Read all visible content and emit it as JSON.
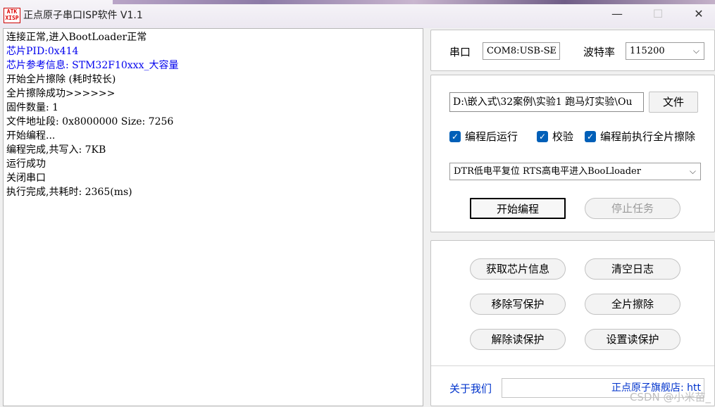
{
  "window": {
    "icon_text": "ATK XISP",
    "title": "正点原子串口ISP软件 V1.1",
    "minimize": "—",
    "maximize": "☐",
    "close": "✕"
  },
  "log": [
    {
      "text": "连接正常,进入BootLoader正常",
      "color": "#000000"
    },
    {
      "text": "芯片PID:0x414",
      "color": "#0000ee"
    },
    {
      "text": "芯片参考信息: STM32F10xxx_大容量",
      "color": "#0000ee"
    },
    {
      "text": "开始全片擦除 (耗时较长)",
      "color": "#000000"
    },
    {
      "text": "全片擦除成功>>>>>>",
      "color": "#000000"
    },
    {
      "text": "固件数量: 1",
      "color": "#000000"
    },
    {
      "text": "文件地址段: 0x8000000 Size: 7256",
      "color": "#000000"
    },
    {
      "text": "开始编程...",
      "color": "#000000"
    },
    {
      "text": "编程完成,共写入: 7KB",
      "color": "#000000"
    },
    {
      "text": "运行成功",
      "color": "#000000"
    },
    {
      "text": "关闭串口",
      "color": "#000000"
    },
    {
      "text": "执行完成,共耗时: 2365(ms)",
      "color": "#000000"
    }
  ],
  "serial": {
    "port_label": "串口",
    "port_value": "COM8:USB-SE",
    "baud_label": "波特率",
    "baud_value": "115200"
  },
  "program": {
    "file_path": "D:\\嵌入式\\32案例\\实验1 跑马灯实验\\Ou",
    "file_button": "文件",
    "checkboxes": [
      {
        "label": "编程后运行",
        "checked": true
      },
      {
        "label": "校验",
        "checked": true
      },
      {
        "label": "编程前执行全片擦除",
        "checked": true
      }
    ],
    "mode_value": "DTR低电平复位 RTS高电平进入BooLloader",
    "start_button": "开始编程",
    "stop_button": "停止任务"
  },
  "tools": {
    "get_chip_info": "获取芯片信息",
    "clear_log": "清空日志",
    "remove_write_protect": "移除写保护",
    "full_erase": "全片擦除",
    "remove_read_protect": "解除读保护",
    "set_read_protect": "设置读保护"
  },
  "footer": {
    "about_label": "关于我们",
    "shop_text": "正点原子旗舰店: htt",
    "watermark": "CSDN @小米苗_"
  },
  "icons": {
    "dropdown": "chevron-down-icon",
    "check": "checkmark-icon"
  },
  "colors": {
    "accent": "#005fb8",
    "log_blue": "#0000ee",
    "link_blue": "#0033cc"
  }
}
